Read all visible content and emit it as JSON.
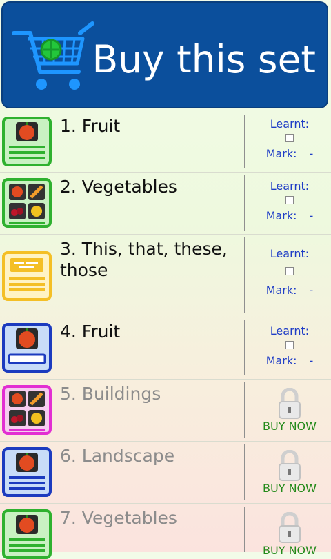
{
  "header": {
    "title": "Buy this set"
  },
  "labels": {
    "learnt": "Learnt:",
    "mark": "Mark:",
    "mark_value": "-",
    "buy_now": "BUY NOW"
  },
  "colors": {
    "green": "#2fb12f",
    "yellow": "#f4bf26",
    "blue": "#1c3bbf",
    "magenta": "#e22fd2"
  },
  "items": [
    {
      "label": "1. Fruit",
      "locked": false,
      "icon": "fruit-card-icon"
    },
    {
      "label": "2. Vegetables",
      "locked": false,
      "icon": "vegetables-grid-icon"
    },
    {
      "label": "3. This, that, these, those",
      "locked": false,
      "icon": "text-card-icon"
    },
    {
      "label": "4. Fruit",
      "locked": false,
      "icon": "fruit-input-icon"
    },
    {
      "label": "5. Buildings",
      "locked": true,
      "icon": "grid-card-icon"
    },
    {
      "label": "6. Landscape",
      "locked": true,
      "icon": "landscape-card-icon"
    },
    {
      "label": "7. Vegetables",
      "locked": true,
      "icon": "vegetables-card-icon"
    }
  ]
}
